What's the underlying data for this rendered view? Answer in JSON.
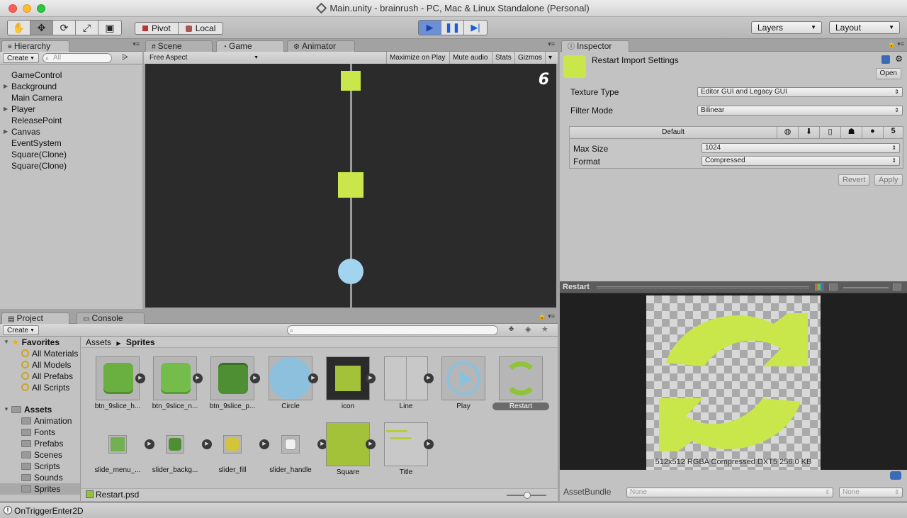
{
  "window": {
    "title": "Main.unity - brainrush - PC, Mac & Linux Standalone (Personal)"
  },
  "toolbar": {
    "pivot": "Pivot",
    "local": "Local",
    "layers": "Layers",
    "layout": "Layout"
  },
  "hierarchy": {
    "tab": "Hierarchy",
    "create": "Create",
    "search_placeholder": "All",
    "items": [
      {
        "label": "GameControl"
      },
      {
        "label": "Background"
      },
      {
        "label": "Main Camera"
      },
      {
        "label": "Player"
      },
      {
        "label": "ReleasePoint"
      },
      {
        "label": "Canvas"
      },
      {
        "label": "EventSystem"
      },
      {
        "label": "Square(Clone)"
      },
      {
        "label": "Square(Clone)"
      }
    ]
  },
  "game": {
    "tabs": {
      "scene": "Scene",
      "game": "Game",
      "animator": "Animator"
    },
    "aspect": "Free Aspect",
    "maximize": "Maximize on Play",
    "mute": "Mute audio",
    "stats": "Stats",
    "gizmos": "Gizmos",
    "score": "6",
    "colors": {
      "background": "#2b2b2b",
      "square": "#c9e64a",
      "circle": "#a3d4ef",
      "line": "#9a9a9a"
    }
  },
  "project": {
    "tabs": {
      "project": "Project",
      "console": "Console"
    },
    "create": "Create",
    "favorites": {
      "title": "Favorites",
      "items": [
        {
          "label": "All Materials"
        },
        {
          "label": "All Models"
        },
        {
          "label": "All Prefabs"
        },
        {
          "label": "All Scripts"
        }
      ]
    },
    "assets": {
      "title": "Assets",
      "folders": [
        {
          "label": "Animation"
        },
        {
          "label": "Fonts"
        },
        {
          "label": "Prefabs"
        },
        {
          "label": "Scenes"
        },
        {
          "label": "Scripts"
        },
        {
          "label": "Sounds"
        },
        {
          "label": "Sprites"
        }
      ]
    },
    "breadcrumb": {
      "root": "Assets",
      "current": "Sprites"
    },
    "grid_row1": [
      {
        "label": "btn_9slice_h...",
        "thumb": "btn-dark"
      },
      {
        "label": "btn_9slice_n...",
        "thumb": "btn-normal"
      },
      {
        "label": "btn_9slice_p...",
        "thumb": "btn-pressed"
      },
      {
        "label": "Circle",
        "thumb": "circle"
      },
      {
        "label": "icon",
        "thumb": "icon"
      },
      {
        "label": "Line",
        "thumb": "line"
      },
      {
        "label": "Play",
        "thumb": "play"
      },
      {
        "label": "Restart",
        "thumb": "restart"
      }
    ],
    "grid_row2": [
      {
        "label": "slide_menu_...",
        "thumb": "small-green"
      },
      {
        "label": "slider_backg...",
        "thumb": "small-darkgreen"
      },
      {
        "label": "slider_fill",
        "thumb": "small-yellow"
      },
      {
        "label": "slider_handle",
        "thumb": "small-white"
      },
      {
        "label": "Square",
        "thumb": "square"
      },
      {
        "label": "Title",
        "thumb": "title"
      }
    ],
    "selected_file": "Restart.psd"
  },
  "inspector": {
    "tab": "Inspector",
    "title": "Restart Import Settings",
    "open": "Open",
    "texture_type_label": "Texture Type",
    "texture_type_value": "Editor GUI and Legacy GUI",
    "filter_mode_label": "Filter Mode",
    "filter_mode_value": "Bilinear",
    "platform_default": "Default",
    "max_size_label": "Max Size",
    "max_size_value": "1024",
    "format_label": "Format",
    "format_value": "Compressed",
    "revert": "Revert",
    "apply": "Apply"
  },
  "preview": {
    "title": "Restart",
    "info": "512x512  RGBA Compressed DXT5   256.0 KB",
    "assetbundle_label": "AssetBundle",
    "assetbundle_value": "None",
    "variant_value": "None",
    "colors": {
      "icon": "#c9e64a"
    }
  },
  "status": {
    "message": "OnTriggerEnter2D"
  }
}
